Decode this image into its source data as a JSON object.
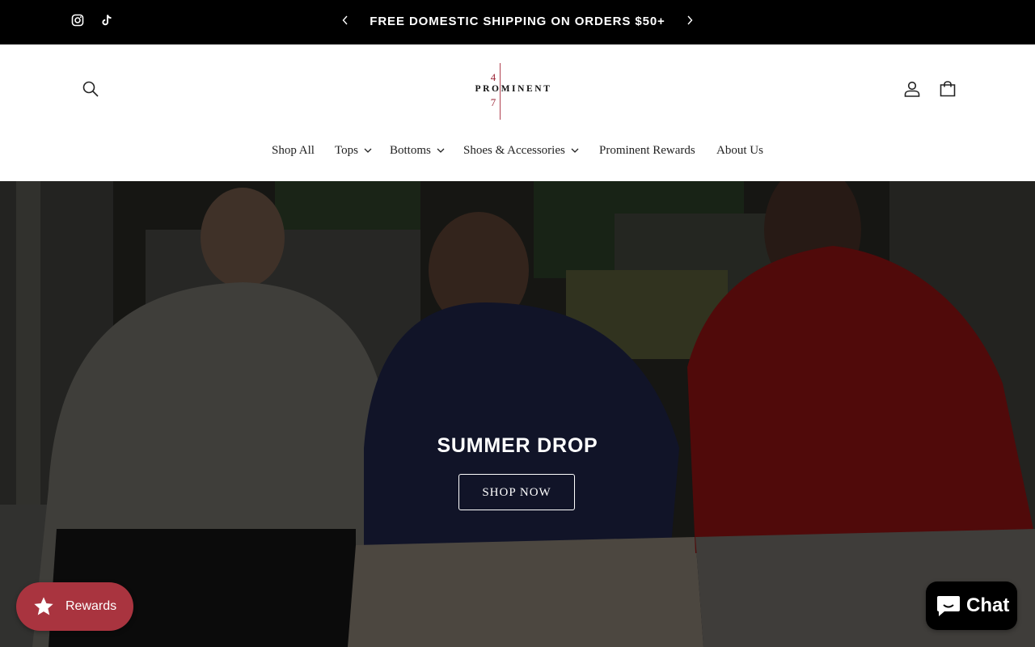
{
  "announcement": {
    "text": "FREE DOMESTIC SHIPPING ON ORDERS $50+",
    "social": [
      "instagram-icon",
      "tiktok-icon"
    ]
  },
  "logo": {
    "top_digit": "4",
    "wordmark": "PROMINENT",
    "bottom_digit": "7"
  },
  "nav": [
    {
      "label": "Shop All",
      "has_dropdown": false
    },
    {
      "label": "Tops",
      "has_dropdown": true
    },
    {
      "label": "Bottoms",
      "has_dropdown": true
    },
    {
      "label": "Shoes & Accessories",
      "has_dropdown": true
    },
    {
      "label": "Prominent Rewards",
      "has_dropdown": false
    },
    {
      "label": "About Us",
      "has_dropdown": false
    }
  ],
  "header_icons": [
    "search-icon",
    "account-icon",
    "cart-icon"
  ],
  "hero": {
    "title": "SUMMER DROP",
    "button": "SHOP NOW"
  },
  "rewards": {
    "label": "Rewards",
    "color": "#a9343f"
  },
  "chat": {
    "label": "Chat"
  }
}
